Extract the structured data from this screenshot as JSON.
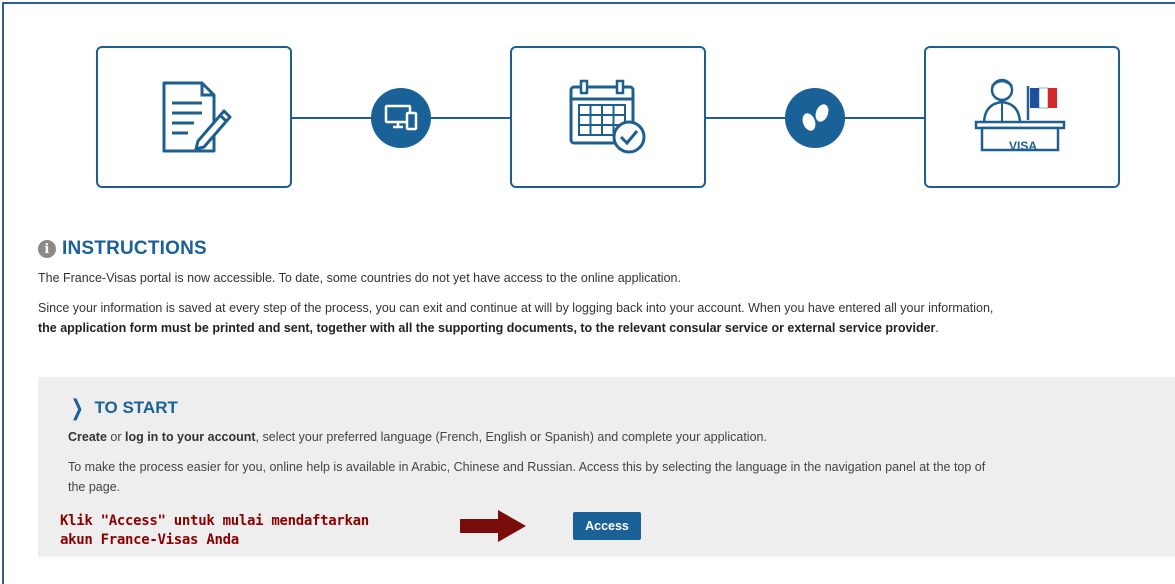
{
  "steps": {
    "visa_sign_text": "VISA"
  },
  "instructions": {
    "title": "INSTRUCTIONS",
    "line1": "The France-Visas portal is now accessible. To date, some countries do not yet have access to the online application.",
    "line2": "Since your information is saved at every step of the process, you can exit and continue at will by logging back into your account. When you have entered all your information,",
    "line3_bold": "the application form must be printed and sent, together with all the supporting documents, to the relevant consular service or external service provider",
    "line3_end": "."
  },
  "to_start": {
    "title": "TO START",
    "create": "Create",
    "or": " or ",
    "login": "log in to your account",
    "rest": ", select your preferred language (French, English or Spanish) and complete your application.",
    "help_line1": "To make the process easier for you, online help is available in Arabic, Chinese and Russian. Access this by selecting the language in the navigation panel at the top of",
    "help_line2": "the page.",
    "access_label": "Access"
  },
  "annotation": {
    "line1": "Klik \"Access\" untuk mulai mendaftarkan",
    "line2": "akun France-Visas Anda"
  },
  "colors": {
    "brand_blue": "#1a6198",
    "annotation_red": "#8b0000",
    "panel_bg": "#eeeeee"
  }
}
